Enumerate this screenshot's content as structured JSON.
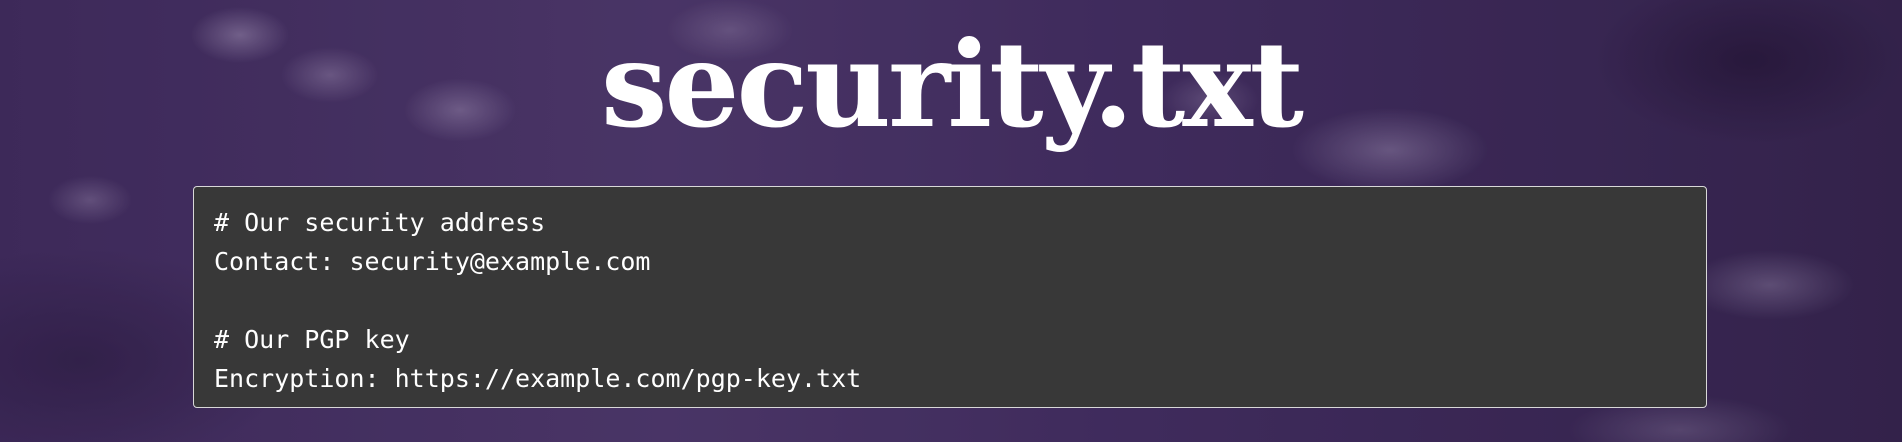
{
  "page": {
    "title": "security.txt"
  },
  "code": {
    "lines": [
      "# Our security address",
      "Contact: security@example.com",
      "",
      "# Our PGP key",
      "Encryption: https://example.com/pgp-key.txt"
    ]
  },
  "colors": {
    "background": "#3a2a52",
    "code_background": "#383838",
    "code_border": "#d8d8d8",
    "text": "#ffffff"
  }
}
